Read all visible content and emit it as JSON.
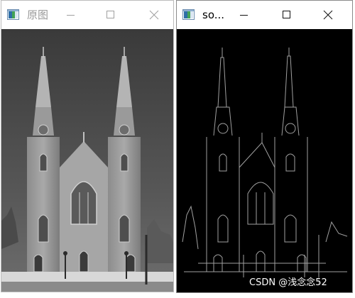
{
  "windows": [
    {
      "title": "原图",
      "icon": "opencv-window-icon",
      "active": false,
      "image": "grayscale photograph of a twin-spired church"
    },
    {
      "title": "so...",
      "icon": "opencv-window-icon",
      "active": true,
      "image": "sobel edge detection result of the church photograph"
    }
  ],
  "controls": {
    "minimize": "minimize-icon",
    "maximize": "maximize-icon",
    "close": "close-icon"
  },
  "watermark": "CSDN @浅念念52",
  "colors": {
    "inactive_title": "#9a9a9a",
    "active_title": "#000000",
    "edge_background": "#000000",
    "edge_lines": "#c8c8c8"
  }
}
